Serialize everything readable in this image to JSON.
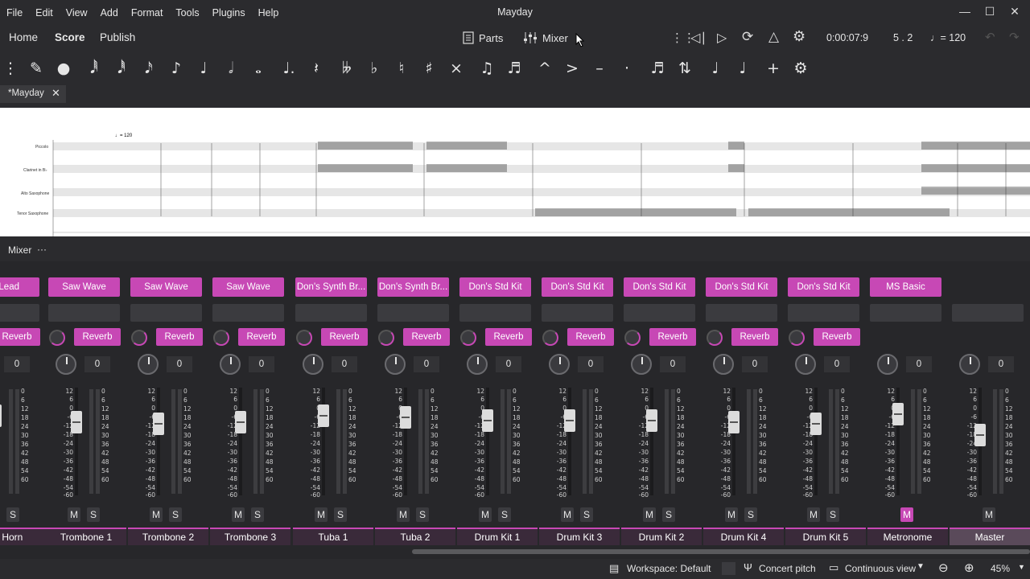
{
  "window": {
    "title": "Mayday"
  },
  "menu": [
    "File",
    "Edit",
    "View",
    "Add",
    "Format",
    "Tools",
    "Plugins",
    "Help"
  ],
  "nav": {
    "tabs": [
      "Home",
      "Score",
      "Publish"
    ],
    "active": "Score",
    "parts_label": "Parts",
    "mixer_label": "Mixer"
  },
  "playback": {
    "time": "0:00:07:9",
    "position": "5 . 2",
    "tempo": "= 120"
  },
  "document_tab": {
    "label": "*Mayday"
  },
  "score": {
    "tempo_mark": "= 120",
    "instruments": [
      "Piccolo",
      "Clarinet in B♭",
      "Alto Saxophone",
      "Tenor Saxophone"
    ]
  },
  "mixer": {
    "title": "Mixer",
    "menu_label": "···",
    "reverb_label": "Reverb",
    "pan_value": "0",
    "scale_db": [
      "12",
      "6",
      "0",
      "-6",
      "-12",
      "-18",
      "-24",
      "-30",
      "-36",
      "-42",
      "-48",
      "-54",
      "-60"
    ],
    "scale_db_right": [
      "0",
      "6",
      "12",
      "18",
      "24",
      "30",
      "36",
      "42",
      "48",
      "54",
      "60"
    ],
    "mute_label": "M",
    "solo_label": "S",
    "channels": [
      {
        "patch": "re Lead",
        "name": "ne Horn"
      },
      {
        "patch": "Saw Wave",
        "name": "Trombone 1"
      },
      {
        "patch": "Saw Wave",
        "name": "Trombone 2"
      },
      {
        "patch": "Saw Wave",
        "name": "Trombone 3"
      },
      {
        "patch": "Don's Synth Br...",
        "name": "Tuba 1"
      },
      {
        "patch": "Don's Synth Br...",
        "name": "Tuba 2"
      },
      {
        "patch": "Don's Std Kit",
        "name": "Drum Kit 1"
      },
      {
        "patch": "Don's Std Kit",
        "name": "Drum Kit 3"
      },
      {
        "patch": "Don's Std Kit",
        "name": "Drum Kit 2"
      },
      {
        "patch": "Don's Std Kit",
        "name": "Drum Kit 4"
      },
      {
        "patch": "Don's Std Kit",
        "name": "Drum Kit 5"
      },
      {
        "patch": "MS Basic",
        "name": "Metronome"
      },
      {
        "patch": "",
        "name": "Master"
      }
    ]
  },
  "status": {
    "workspace": "Workspace: Default",
    "concert_pitch": "Concert pitch",
    "view_mode": "Continuous view",
    "zoom": "45%"
  },
  "colors": {
    "accent": "#c748b5",
    "background": "#2b2b2e"
  }
}
